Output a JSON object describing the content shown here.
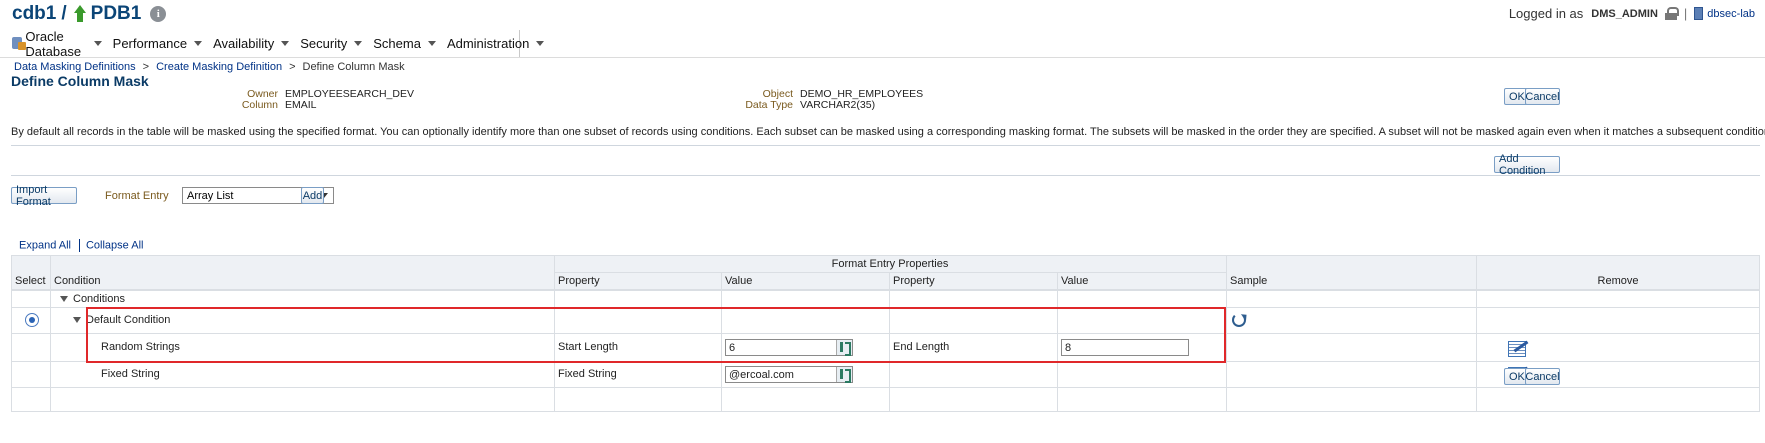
{
  "header": {
    "cdb": "cdb1",
    "slash": "/",
    "pdb": "PDB1",
    "logged_in_as": "Logged in as",
    "user": "DMS_ADMIN",
    "separator": "|",
    "host": "dbsec-lab"
  },
  "menu": [
    {
      "label": "Oracle Database"
    },
    {
      "label": "Performance"
    },
    {
      "label": "Availability"
    },
    {
      "label": "Security"
    },
    {
      "label": "Schema"
    },
    {
      "label": "Administration"
    }
  ],
  "breadcrumb": [
    "Data Masking Definitions",
    ">",
    "Create Masking Definition",
    ">",
    "Define Column Mask"
  ],
  "page_title": "Define Column Mask",
  "info": {
    "owner_label": "Owner",
    "owner": "EMPLOYEESEARCH_DEV",
    "column_label": "Column",
    "column": "EMAIL",
    "object_label": "Object",
    "object": "DEMO_HR_EMPLOYEES",
    "datatype_label": "Data Type",
    "datatype": "VARCHAR2(35)"
  },
  "buttons": {
    "ok": "OK",
    "cancel": "Cancel",
    "add_condition": "Add Condition",
    "import_format": "Import Format",
    "add": "Add"
  },
  "description": "By default all records in the table will be masked using the specified format. You can optionally identify more than one subset of records using conditions. Each subset can be masked using a corresponding masking format. The subsets will be masked in the order they are specified. A subset will not be masked again even when it matches a subsequent condition.",
  "format_entry": {
    "label": "Format Entry",
    "selected": "Array List"
  },
  "expand_all": "Expand All",
  "collapse_all": "Collapse All",
  "table": {
    "group_header": "Format Entry Properties",
    "headers": {
      "select": "Select",
      "condition": "Condition",
      "property1": "Property",
      "value1": "Value",
      "property2": "Property",
      "value2": "Value",
      "sample": "Sample",
      "remove": "Remove"
    },
    "rows": {
      "conditions": "Conditions",
      "default_condition": "Default Condition",
      "random_strings": {
        "name": "Random Strings",
        "prop1": "Start Length",
        "val1": "6",
        "prop2": "End Length",
        "val2": "8"
      },
      "fixed_string": {
        "name": "Fixed String",
        "prop1": "Fixed String",
        "val1": "@ercoal.com"
      }
    }
  }
}
